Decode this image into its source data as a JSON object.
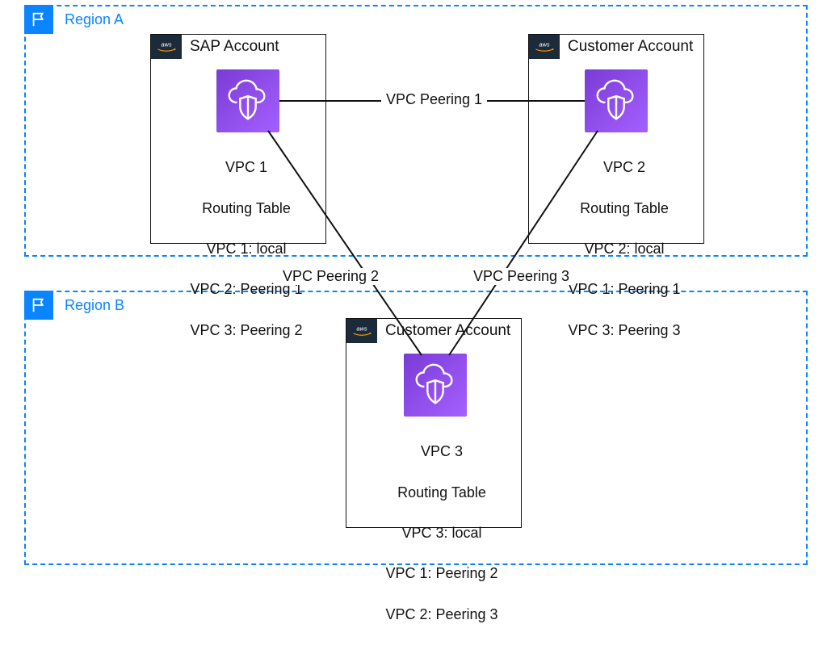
{
  "regionA": {
    "label": "Region A"
  },
  "regionB": {
    "label": "Region B"
  },
  "accountSAP": {
    "title": "SAP Account"
  },
  "accountCustA": {
    "title": "Customer Account"
  },
  "accountCustB": {
    "title": "Customer Account"
  },
  "vpc1": {
    "name": "VPC 1",
    "rtTitle": "Routing Table",
    "r1": "VPC 1: local",
    "r2": "VPC 2: Peering 1",
    "r3": "VPC 3: Peering 2"
  },
  "vpc2": {
    "name": "VPC 2",
    "rtTitle": "Routing Table",
    "r1": "VPC 2: local",
    "r2": "VPC 1: Peering 1",
    "r3": "VPC 3: Peering 3"
  },
  "vpc3": {
    "name": "VPC 3",
    "rtTitle": "Routing Table",
    "r1": "VPC 3: local",
    "r2": "VPC 1: Peering 2",
    "r3": "VPC 2: Peering 3"
  },
  "peering1": {
    "label": "VPC Peering 1"
  },
  "peering2": {
    "label": "VPC Peering 2"
  },
  "peering3": {
    "label": "VPC Peering 3"
  }
}
